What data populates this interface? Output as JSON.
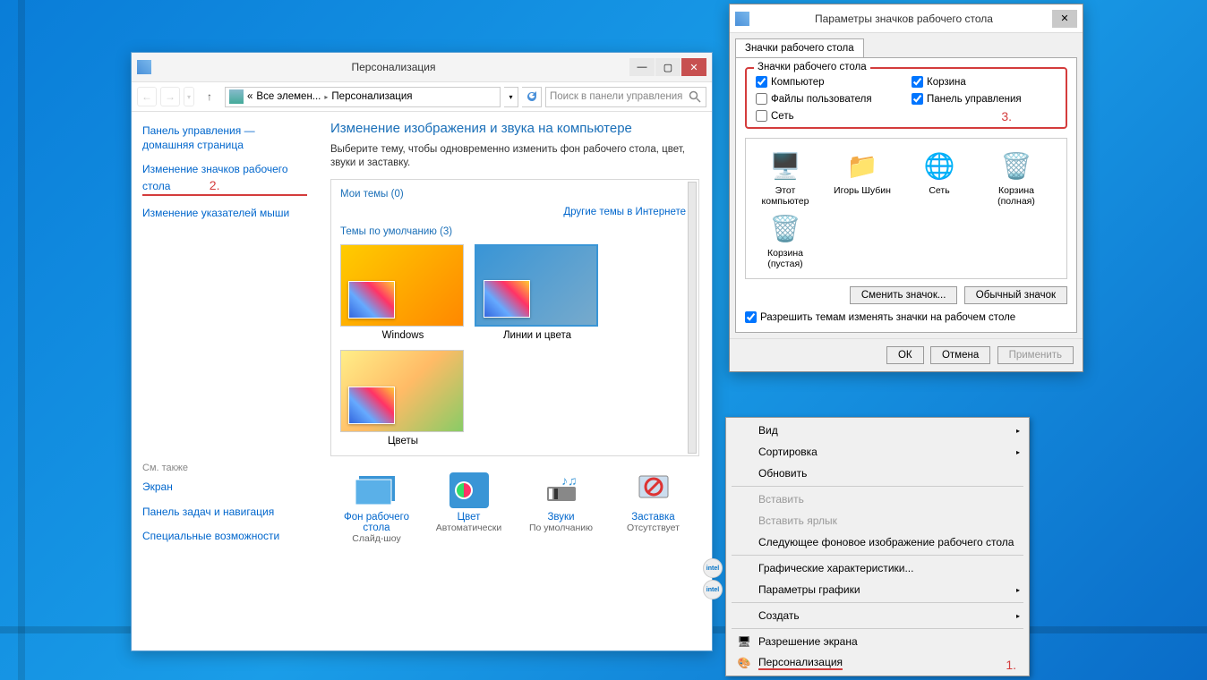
{
  "main_window": {
    "title": "Персонализация",
    "nav": {
      "crumb1_prefix": "«",
      "crumb1": "Все элемен...",
      "crumb2": "Персонализация",
      "search_placeholder": "Поиск в панели управления"
    },
    "sidebar": {
      "home": "Панель управления — домашняя страница",
      "icons": "Изменение значков рабочего стола",
      "pointers": "Изменение указателей мыши",
      "also_h": "См. также",
      "also1": "Экран",
      "also2": "Панель задач и навигация",
      "also3": "Специальные возможности",
      "ann2": "2."
    },
    "content": {
      "heading": "Изменение изображения и звука на компьютере",
      "desc": "Выберите тему, чтобы одновременно изменить фон рабочего стола, цвет, звуки и заставку.",
      "my_themes": "Мои темы (0)",
      "online_link": "Другие темы в Интернете",
      "default_themes": "Темы по умолчанию (3)",
      "theme1": "Windows",
      "theme2": "Линии и цвета",
      "theme3": "Цветы",
      "setting_bg_label": "Фон рабочего стола",
      "setting_bg_val": "Слайд-шоу",
      "setting_color_label": "Цвет",
      "setting_color_val": "Автоматически",
      "setting_sound_label": "Звуки",
      "setting_sound_val": "По умолчанию",
      "setting_saver_label": "Заставка",
      "setting_saver_val": "Отсутствует"
    }
  },
  "dialog": {
    "title": "Параметры значков рабочего стола",
    "tab": "Значки рабочего стола",
    "group_legend": "Значки рабочего стола",
    "chk_computer": "Компьютер",
    "chk_recycle": "Корзина",
    "chk_userfiles": "Файлы пользователя",
    "chk_control": "Панель управления",
    "chk_network": "Сеть",
    "ann3": "3.",
    "icons": {
      "pc": "Этот компьютер",
      "user": "Игорь Шубин",
      "net": "Сеть",
      "bin_full": "Корзина (полная)",
      "bin_empty": "Корзина (пустая)"
    },
    "btn_change": "Сменить значок...",
    "btn_default": "Обычный значок",
    "allow_themes": "Разрешить темам изменять значки на рабочем столе",
    "ok": "ОК",
    "cancel": "Отмена",
    "apply": "Применить"
  },
  "context_menu": {
    "view": "Вид",
    "sort": "Сортировка",
    "refresh": "Обновить",
    "paste": "Вставить",
    "paste_shortcut": "Вставить ярлык",
    "next_bg": "Следующее фоновое изображение рабочего стола",
    "gfx_props": "Графические характеристики...",
    "gfx_params": "Параметры графики",
    "create": "Создать",
    "resolution": "Разрешение экрана",
    "personalize": "Персонализация",
    "ann1": "1."
  }
}
